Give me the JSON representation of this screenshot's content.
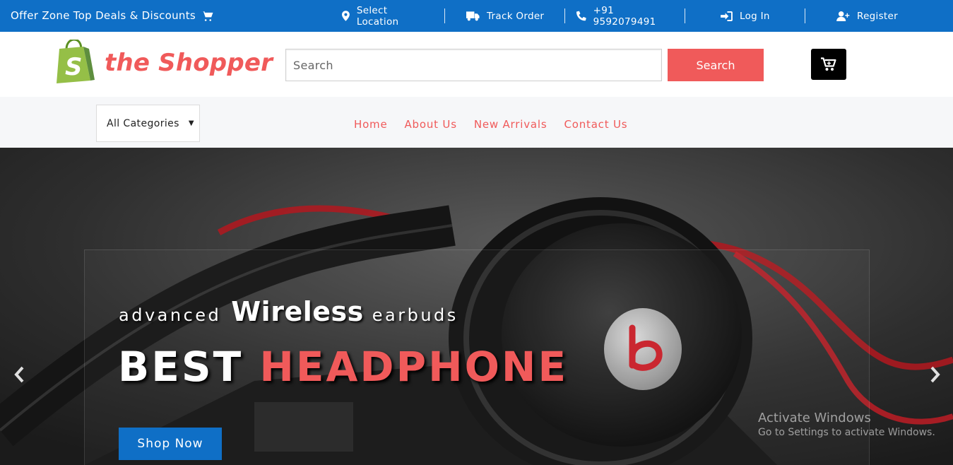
{
  "topbar": {
    "offer": "Offer Zone Top Deals & Discounts",
    "select_location": "Select Location",
    "track_order": "Track Order",
    "phone": "+91 9592079491",
    "login": "Log In",
    "register": "Register"
  },
  "header": {
    "brand": "the Shopper",
    "search_placeholder": "Search",
    "search_button": "Search"
  },
  "nav": {
    "category": "All Categories",
    "items": [
      "Home",
      "About Us",
      "New Arrivals",
      "Contact Us"
    ]
  },
  "hero": {
    "sub_left": "advanced",
    "sub_big": "Wireless",
    "sub_right": "earbuds",
    "headline_white": "BEST",
    "headline_red": "HEADPHONE",
    "cta": "Shop Now"
  },
  "watermark": {
    "line1": "Activate Windows",
    "line2": "Go to Settings to activate Windows."
  },
  "colors": {
    "topbar": "#0f6fc6",
    "accent": "#f05a5a",
    "nav_bg": "#f6f7f9"
  }
}
